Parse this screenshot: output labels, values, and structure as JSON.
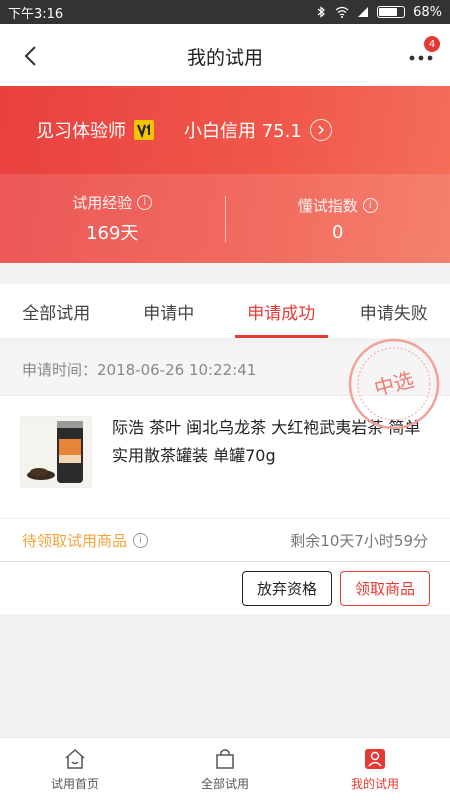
{
  "status_bar": {
    "time": "下午3:16",
    "battery": "68%",
    "battery_level": 0.68
  },
  "nav": {
    "title": "我的试用",
    "badge": "4"
  },
  "hero": {
    "role": "见习体验师",
    "vip_badge": "V1",
    "credit_label": "小白信用 75.1",
    "trial_exp_label": "试用经验",
    "trial_exp_value": "169天",
    "index_label": "懂试指数",
    "index_value": "0"
  },
  "tabs": [
    {
      "label": "全部试用"
    },
    {
      "label": "申请中"
    },
    {
      "label": "申请成功"
    },
    {
      "label": "申请失败"
    }
  ],
  "order": {
    "apply_time": "申请时间：2018-06-26 10:22:41",
    "stamp_text": "中选",
    "product_name": "际浩 茶叶 闽北乌龙茶 大红袍武夷岩茶 简单实用散茶罐装 单罐70g",
    "pending_label": "待领取试用商品",
    "remaining": "剩余10天7小时59分",
    "give_up_label": "放弃资格",
    "claim_label": "领取商品"
  },
  "bottom_nav": [
    {
      "label": "试用首页",
      "icon": "home-icon"
    },
    {
      "label": "全部试用",
      "icon": "bag-icon"
    },
    {
      "label": "我的试用",
      "icon": "user-icon"
    }
  ],
  "colors": {
    "accent": "#e53935",
    "pending": "#f2a33a",
    "vip": "#f5c400"
  }
}
